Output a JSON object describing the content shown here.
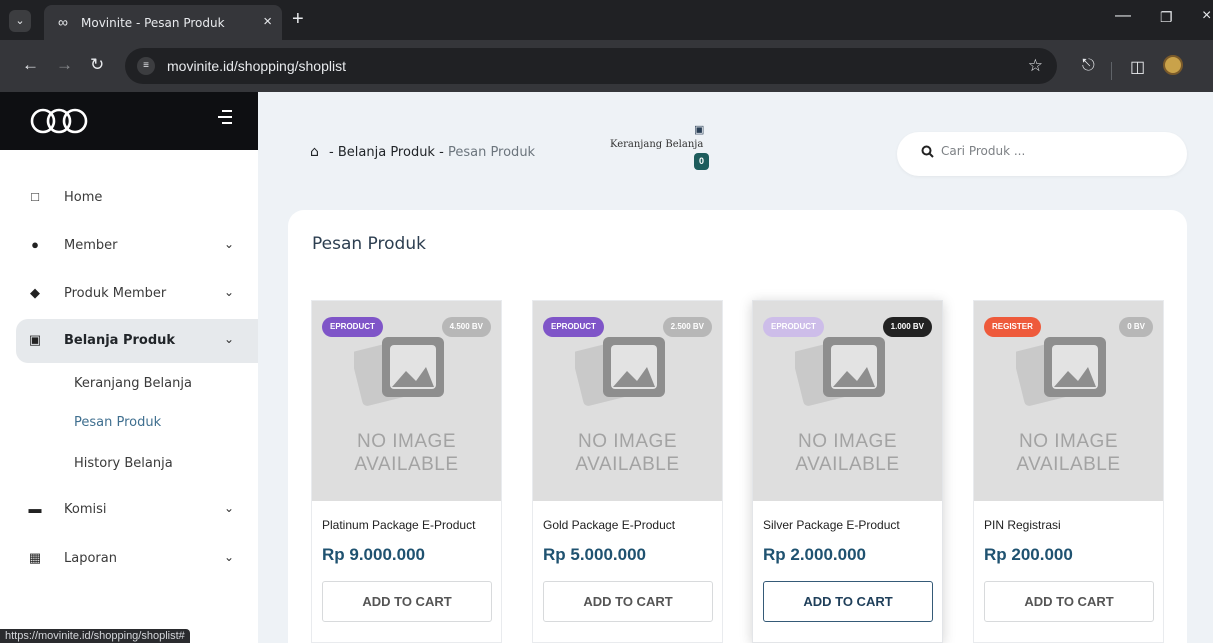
{
  "browser": {
    "tab_title": "Movinite - Pesan Produk",
    "url": "movinite.id/shopping/shoplist",
    "status_url": "https://movinite.id/shopping/shoplist#"
  },
  "sidebar": {
    "menu": [
      {
        "label": "Home",
        "icon": "monitor-icon"
      },
      {
        "label": "Member",
        "icon": "user-icon"
      },
      {
        "label": "Produk Member",
        "icon": "tag-icon"
      },
      {
        "label": "Belanja Produk",
        "icon": "shopping-bag-icon"
      },
      {
        "label": "Komisi",
        "icon": "wallet-icon"
      },
      {
        "label": "Laporan",
        "icon": "report-icon"
      }
    ],
    "submenu": [
      "Keranjang Belanja",
      "Pesan Produk",
      "History Belanja"
    ]
  },
  "header": {
    "breadcrumb": {
      "item1": "Belanja Produk",
      "item2": "Pesan Produk",
      "separator": "-"
    },
    "cart": {
      "label": "Keranjang Belanja",
      "count": "0"
    },
    "search_placeholder": "Cari Produk ..."
  },
  "main": {
    "title": "Pesan Produk",
    "no_image": {
      "line1": "NO IMAGE",
      "line2": "AVAILABLE"
    },
    "products": [
      {
        "category": "EPRODUCT",
        "bv": "4.500 BV",
        "name": "Platinum Package E-Product",
        "price": "Rp 9.000.000",
        "button": "ADD TO CART"
      },
      {
        "category": "EPRODUCT",
        "bv": "2.500 BV",
        "name": "Gold Package E-Product",
        "price": "Rp 5.000.000",
        "button": "ADD TO CART"
      },
      {
        "category": "EPRODUCT",
        "bv": "1.000 BV",
        "name": "Silver Package E-Product",
        "price": "Rp 2.000.000",
        "button": "ADD TO CART"
      },
      {
        "category": "REGISTER",
        "bv": "0 BV",
        "name": "PIN Registrasi",
        "price": "Rp 200.000",
        "button": "ADD TO CART"
      }
    ]
  },
  "colors": {
    "eproduct_chip": "#7f55c8",
    "eproduct_chip_faded": "#cdbde9",
    "register_chip": "#ee5a3b",
    "price": "#1f5270",
    "cart_badge": "#1d5c5c"
  }
}
